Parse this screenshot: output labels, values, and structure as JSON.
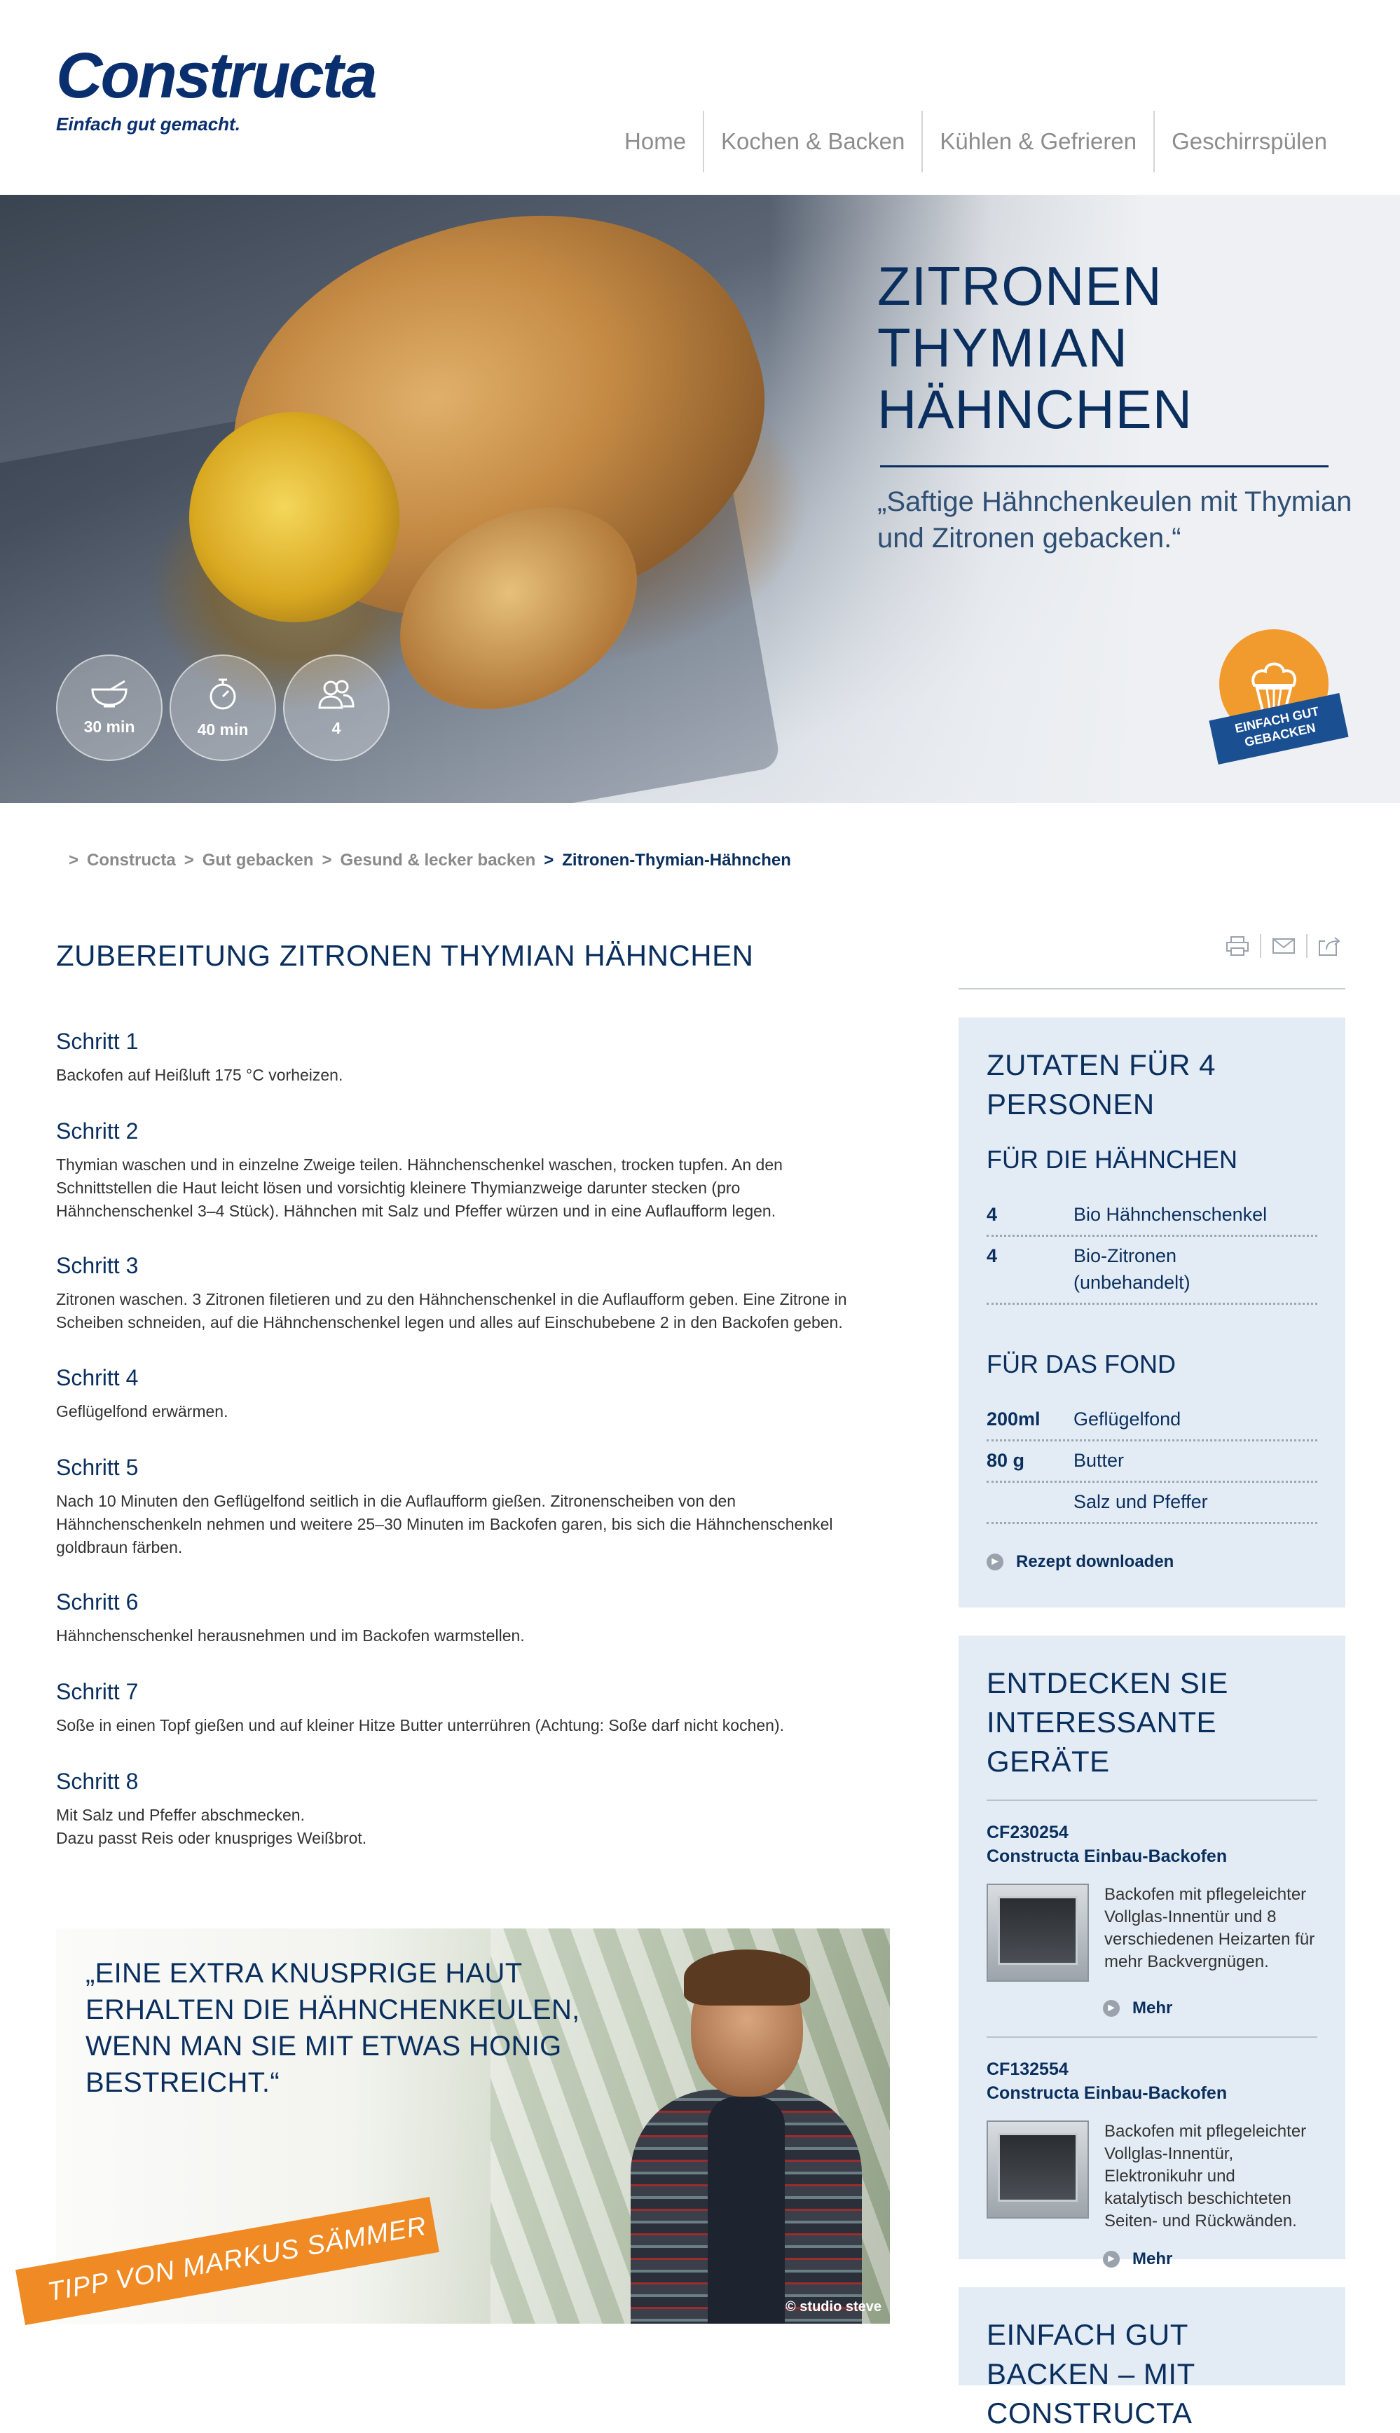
{
  "header": {
    "logo_text": "Constructa",
    "logo_tagline": "Einfach gut gemacht.",
    "nav": [
      "Home",
      "Kochen & Backen",
      "Kühlen & Gefrieren",
      "Geschirrspülen"
    ]
  },
  "hero": {
    "title_lines": [
      "ZITRONEN",
      "THYMIAN",
      "HÄHNCHEN"
    ],
    "quote": "„Saftige Hähnchenkeulen mit Thymian und Zitronen gebacken.“",
    "badges": [
      {
        "icon": "mixing-bowl-icon",
        "label": "30 min"
      },
      {
        "icon": "stopwatch-icon",
        "label": "40 min"
      },
      {
        "icon": "persons-icon",
        "label": "4"
      }
    ],
    "seal_text": "EINFACH GUT GEBACKEN"
  },
  "breadcrumb": [
    "Constructa",
    "Gut gebacken",
    "Gesund & lecker backen",
    "Zitronen-Thymian-Hähnchen"
  ],
  "main": {
    "title": "ZUBEREITUNG ZITRONEN THYMIAN HÄHNCHEN",
    "steps": [
      {
        "title": "Schritt 1",
        "text": "Backofen auf Heißluft 175 °C vorheizen."
      },
      {
        "title": "Schritt 2",
        "text": "Thymian waschen und in einzelne Zweige teilen. Hähnchenschenkel waschen, trocken tupfen. An den\nSchnittstellen die Haut leicht lösen und vorsichtig kleinere Thymianzweige darunter stecken (pro\nHähnchenschenkel 3–4 Stück). Hähnchen mit Salz und Pfeffer würzen und in eine Auflaufform legen."
      },
      {
        "title": "Schritt 3",
        "text": "Zitronen waschen. 3 Zitronen filetieren und zu den Hähnchenschenkel in die Auflaufform geben. Eine Zitrone in\nScheiben schneiden, auf die Hähnchenschenkel legen und alles auf Einschubebene 2 in den Backofen geben."
      },
      {
        "title": "Schritt 4",
        "text": "Geflügelfond erwärmen."
      },
      {
        "title": "Schritt 5",
        "text": "Nach 10 Minuten den Geflügelfond seitlich in die Auflaufform gießen. Zitronenscheiben von den\nHähnchenschenkeln nehmen und weitere 25–30 Minuten im Backofen garen, bis sich die Hähnchenschenkel\ngoldbraun färben."
      },
      {
        "title": "Schritt 6",
        "text": "Hähnchenschenkel herausnehmen und im Backofen warmstellen."
      },
      {
        "title": "Schritt 7",
        "text": "Soße in einen Topf gießen und auf kleiner Hitze Butter unterrühren (Achtung: Soße darf nicht kochen)."
      },
      {
        "title": "Schritt 8",
        "text": "Mit Salz und Pfeffer abschmecken.\nDazu passt Reis oder knuspriges Weißbrot."
      }
    ]
  },
  "promo": {
    "quote": "„EINE EXTRA KNUSPRIGE HAUT ERHALTEN DIE HÄHNCHENKEULEN, WENN MAN SIE MIT ETWAS HONIG BESTREICHT.“",
    "ribbon": "TIPP VON MARKUS SÄMMER",
    "credit": "© studio steve"
  },
  "ingredients": {
    "title": "ZUTATEN FÜR 4 PERSONEN",
    "groups": [
      {
        "title": "FÜR DIE HÄHNCHEN",
        "items": [
          {
            "qty": "4",
            "name": "Bio Hähnchenschenkel"
          },
          {
            "qty": "4",
            "name": "Bio-Zitronen (unbehandelt)"
          }
        ]
      },
      {
        "title": "FÜR DAS FOND",
        "items": [
          {
            "qty": "200ml",
            "name": "Geflügelfond"
          },
          {
            "qty": "80 g",
            "name": "Butter"
          },
          {
            "qty": "",
            "name": "Salz und Pfeffer"
          }
        ]
      }
    ],
    "download_label": "Rezept downloaden"
  },
  "devices": {
    "title": "ENTDECKEN SIE INTERESSANTE GERÄTE",
    "items": [
      {
        "model": "CF230254",
        "name": "Constructa Einbau-Backofen",
        "desc": "Backofen mit pflegeleichter Vollglas-Innentür und 8 verschiedenen Heizarten für mehr Backvergnügen.",
        "more": "Mehr"
      },
      {
        "model": "CF132554",
        "name": "Constructa Einbau-Backofen",
        "desc": "Backofen mit pflegeleichter Vollglas-Innentür, Elektronikuhr und katalytisch beschichteten Seiten- und Rückwänden.",
        "more": "Mehr"
      }
    ]
  },
  "baking": {
    "title": "EINFACH GUT BACKEN – MIT CONSTRUCTA"
  }
}
